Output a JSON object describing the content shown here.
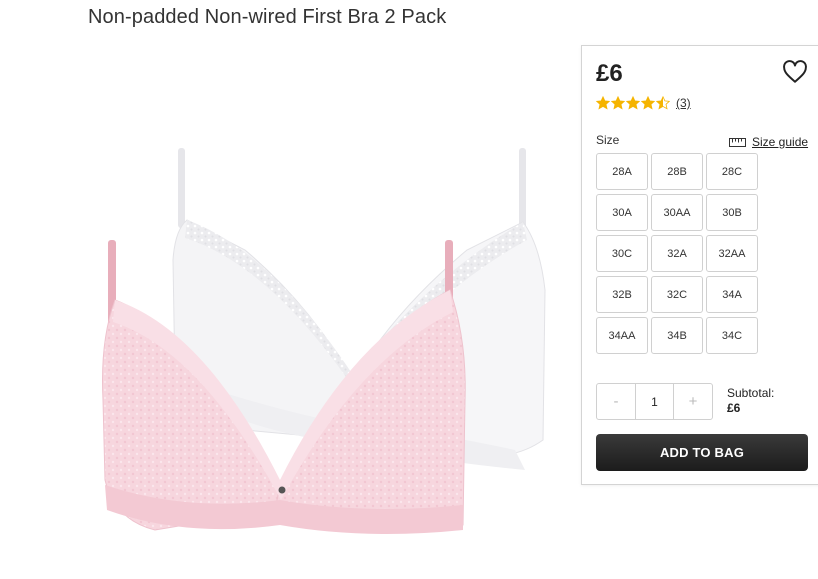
{
  "product": {
    "title": "Non-padded Non-wired First Bra 2 Pack"
  },
  "panel": {
    "price": "£6",
    "rating": {
      "value": 4.5,
      "max": 5,
      "review_count": "(3)"
    },
    "size_label": "Size",
    "size_guide_label": "Size guide",
    "sizes": [
      "28A",
      "28B",
      "28C",
      "30A",
      "30AA",
      "30B",
      "30C",
      "32A",
      "32AA",
      "32B",
      "32C",
      "34A",
      "34AA",
      "34B",
      "34C"
    ],
    "quantity": {
      "minus": "-",
      "value": "1",
      "plus": "+"
    },
    "subtotal_label": "Subtotal:",
    "subtotal_value": "£6",
    "add_to_bag_label": "ADD TO BAG"
  },
  "colors": {
    "star": "#f5b400",
    "button_bg": "#222222",
    "bra_white": "#f4f4f6",
    "bra_pink": "#f6d3dc"
  },
  "icons": {
    "wishlist": "heart-outline-icon",
    "size_guide": "ruler-icon"
  }
}
